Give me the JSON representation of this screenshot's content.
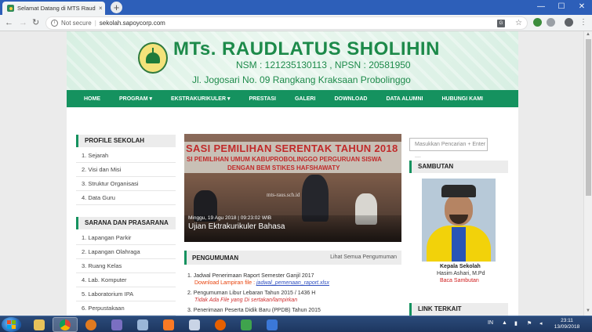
{
  "browser": {
    "tab_title": "Selamat Datang di MTS Raudlatu",
    "tab_close": "×",
    "new_tab": "+",
    "win_min": "—",
    "win_max": "☐",
    "win_close": "✕",
    "not_secure": "Not secure",
    "url": "sekolah.sapoycorp.com"
  },
  "header": {
    "school_name": "MTs. RAUDLATUS SHOLIHIN",
    "nsm_npsn": "NSM : 121235130113 , NPSN : 20581950",
    "address": "Jl. Jogosari No. 09 Rangkang Kraksaan Probolinggo"
  },
  "menu": {
    "items": [
      "HOME",
      "PROGRAM ▾",
      "EKSTRAKURIKULER ▾",
      "PRESTASI",
      "GALERI",
      "DOWNLOAD",
      "DATA ALUMNI",
      "HUBUNGI KAMI"
    ]
  },
  "left": {
    "profile_title": "PROFILE SEKOLAH",
    "profile_items": [
      "1. Sejarah",
      "2. Visi dan Misi",
      "3. Struktur Organisasi",
      "4. Data Guru"
    ],
    "sarana_title": "SARANA DAN PRASARANA",
    "sarana_items": [
      "1. Lapangan Parkir",
      "2. Lapangan Olahraga",
      "3. Ruang Kelas",
      "4. Lab. Komputer",
      "5. Laboratorium IPA",
      "6. Perpustakaan"
    ]
  },
  "slider": {
    "banner_line1": "SASI PEMILIHAN SERENTAK TAHUN 2018",
    "banner_line2": "SI PEMILIHAN UMUM KABUPROBOLINGGO PERGURUAN SISWA",
    "banner_line3": "DENGAN BEM STIKES HAFSHAWATY",
    "watermark": "mts-raus.sch.id",
    "date": "Minggu, 19 Agu 2018 | 09:23:02 WIB",
    "title": "Ujian Ektrakurikuler Bahasa"
  },
  "announcements": {
    "title": "PENGUMUMAN",
    "see_all": "Lihat Semua Pengumuman",
    "items": [
      {
        "text": "1. Jadwal Penerimaan Raport Semester Ganjil 2017",
        "sub_label": "Download Lampiran file : ",
        "sub_link": "jadwal_pemenaan_raport.xlsx"
      },
      {
        "text": "2. Pengumuman Libur Lebaran Tahun 2015 / 1436 H",
        "sub_note": "Tidak Ada File yang Di sertakan/lampirkan"
      },
      {
        "text": "3. Penerimaan Peserta Didik Baru (PPDB) Tahun 2015"
      }
    ]
  },
  "right": {
    "search_placeholder": "Masukkan Pencarian + Enter ....",
    "sambutan_title": "SAMBUTAN",
    "role": "Kepala Sekolah",
    "name": "Hasim Ashari, M.Pd",
    "read_link": "Baca Sambutan",
    "link_terkait_title": "LINK TERKAIT"
  },
  "taskbar": {
    "lang": "IN",
    "time": "23:11",
    "date": "13/09/2018"
  }
}
